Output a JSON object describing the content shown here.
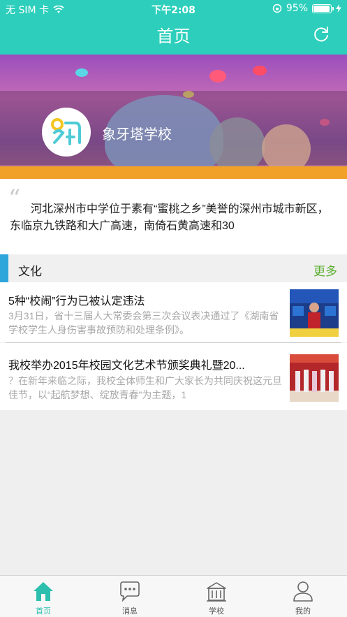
{
  "status_bar": {
    "carrier": "无 SIM 卡",
    "time": "下午2:08",
    "battery_percent": "95%",
    "battery_level": 0.95
  },
  "nav": {
    "title": "首页"
  },
  "banner": {
    "school_name": "象牙塔学校"
  },
  "intro": {
    "text": "河北深州市中学位于素有“蜜桃之乡”美誉的深州市城市新区，东临京九铁路和大广高速，南倚石黄高速和30"
  },
  "culture": {
    "section_title": "文化",
    "more_label": "更多",
    "articles": [
      {
        "title": "5种“校闹”行为已被认定违法",
        "desc": "3月31日，省十三届人大常委会第三次会议表决通过了《湖南省学校学生人身伤害事故预防和处理条例》。"
      },
      {
        "title": "我校举办2015年校园文化艺术节颁奖典礼暨20...",
        "desc": "？在新年来临之际，我校全体师生和广大家长为共同庆祝这元旦佳节，以“起航梦想、绽放青春”为主题，1"
      }
    ]
  },
  "tabbar": {
    "tabs": [
      {
        "label": "首页",
        "icon": "home-icon",
        "active": true
      },
      {
        "label": "消息",
        "icon": "message-icon",
        "active": false
      },
      {
        "label": "学校",
        "icon": "school-icon",
        "active": false
      },
      {
        "label": "我的",
        "icon": "profile-icon",
        "active": false
      }
    ]
  },
  "colors": {
    "accent": "#2dcfbc",
    "section_bar": "#2ea6dc",
    "more": "#5aae2f"
  }
}
